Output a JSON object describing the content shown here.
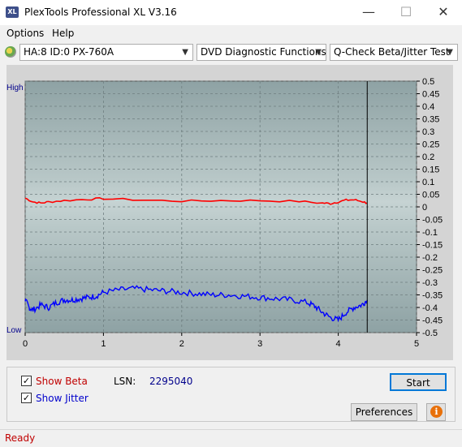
{
  "window": {
    "title": "PlexTools Professional XL V3.16",
    "icon_text": "XL",
    "minimize_glyph": "—",
    "maximize_glyph": "☐",
    "close_glyph": "✕"
  },
  "menu": {
    "options": "Options",
    "help": "Help"
  },
  "toolbar": {
    "drive": "HA:8 ID:0  PX-760A",
    "function": "DVD Diagnostic Functions",
    "test": "Q-Check Beta/Jitter Test"
  },
  "chart_data": {
    "type": "line",
    "left_axis_labels": {
      "high": "High",
      "low": "Low"
    },
    "x": {
      "ticks": [
        "0",
        "1",
        "2",
        "3",
        "4",
        "5"
      ],
      "lim": [
        0,
        5
      ]
    },
    "y_right": {
      "ticks": [
        "0.5",
        "0.45",
        "0.4",
        "0.35",
        "0.3",
        "0.25",
        "0.2",
        "0.15",
        "0.1",
        "0.05",
        "0",
        "-0.05",
        "-0.1",
        "-0.15",
        "-0.2",
        "-0.25",
        "-0.3",
        "-0.35",
        "-0.4",
        "-0.45",
        "-0.5"
      ],
      "lim": [
        -0.5,
        0.5
      ]
    },
    "end_marker_x": 4.37,
    "grid": true,
    "series": [
      {
        "color": "#ff0000",
        "x": [
          0,
          0.1,
          0.2,
          0.3,
          0.5,
          0.8,
          1.0,
          1.5,
          2.0,
          2.5,
          3.0,
          3.5,
          3.8,
          3.9,
          4.0,
          4.1,
          4.2,
          4.3,
          4.37
        ],
        "y": [
          0.035,
          0.02,
          0.015,
          0.02,
          0.025,
          0.03,
          0.033,
          0.027,
          0.023,
          0.025,
          0.025,
          0.022,
          0.015,
          0.013,
          0.02,
          0.027,
          0.028,
          0.022,
          0.015
        ]
      },
      {
        "color": "#0000ff",
        "x": [
          0,
          0.05,
          0.1,
          0.2,
          0.3,
          0.4,
          0.5,
          0.6,
          0.7,
          0.8,
          0.9,
          1.0,
          1.2,
          1.4,
          1.6,
          1.8,
          2.0,
          2.2,
          2.4,
          2.6,
          2.8,
          3.0,
          3.2,
          3.4,
          3.6,
          3.7,
          3.8,
          3.9,
          4.0,
          4.1,
          4.2,
          4.3,
          4.37
        ],
        "y": [
          -0.37,
          -0.4,
          -0.41,
          -0.39,
          -0.4,
          -0.38,
          -0.37,
          -0.37,
          -0.365,
          -0.36,
          -0.355,
          -0.34,
          -0.33,
          -0.325,
          -0.33,
          -0.335,
          -0.34,
          -0.345,
          -0.35,
          -0.35,
          -0.355,
          -0.36,
          -0.365,
          -0.37,
          -0.38,
          -0.395,
          -0.42,
          -0.44,
          -0.45,
          -0.42,
          -0.4,
          -0.39,
          -0.37
        ]
      }
    ]
  },
  "bottom": {
    "show_beta": "Show Beta",
    "show_jitter": "Show Jitter",
    "lsn_label": "LSN:",
    "lsn_value": "2295040",
    "start_button": "Start",
    "preferences_button": "Preferences",
    "info_glyph": "i",
    "check_glyph": "✓"
  },
  "status": {
    "text": "Ready",
    "color": "#c00000"
  }
}
